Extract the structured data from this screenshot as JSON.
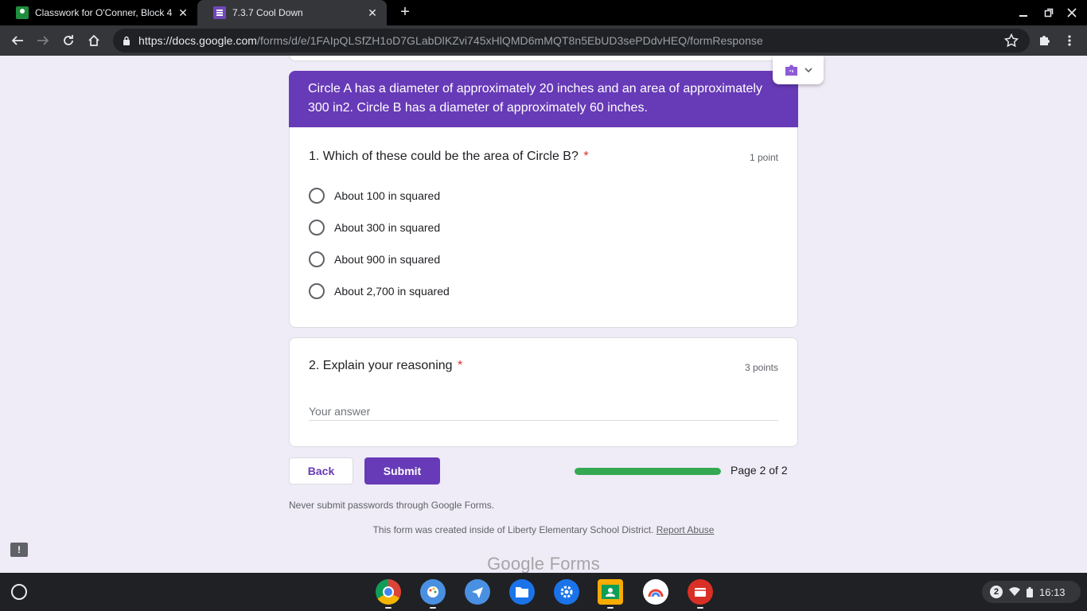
{
  "browser": {
    "tabs": [
      {
        "title": "Classwork for O'Conner, Block 4",
        "active": false
      },
      {
        "title": "7.3.7 Cool Down",
        "active": true
      }
    ],
    "url_host": "https://docs.google.com",
    "url_path": "/forms/d/e/1FAIpQLSfZH1oD7GLabDlKZvi745xHlQMD6mMQT8n5EbUD3sePDdvHEQ/formResponse"
  },
  "form": {
    "section_text": "Circle A has a diameter of approximately 20 inches and an area of approximately 300 in2. Circle B has a diameter of approximately 60 inches.",
    "question1": {
      "title": "1. Which of these could be the area of Circle B?",
      "required_mark": "*",
      "points": "1 point",
      "options": [
        "About 100 in squared",
        "About 300 in squared",
        "About 900 in squared",
        "About 2,700 in squared"
      ]
    },
    "question2": {
      "title": "2. Explain your reasoning",
      "required_mark": "*",
      "points": "3 points",
      "placeholder": "Your answer"
    },
    "back_label": "Back",
    "submit_label": "Submit",
    "progress_percent": 100,
    "page_indicator": "Page 2 of 2",
    "password_note": "Never submit passwords through Google Forms.",
    "created_text": "This form was created inside of Liberty Elementary School District.",
    "report_abuse": "Report Abuse",
    "brand_google": "Google",
    "brand_forms": "Forms",
    "feedback_glyph": "!"
  },
  "shelf": {
    "notification_count": "2",
    "time": "16:13"
  },
  "colors": {
    "accent": "#673ab7",
    "progress": "#34a853",
    "required": "#d93025"
  }
}
